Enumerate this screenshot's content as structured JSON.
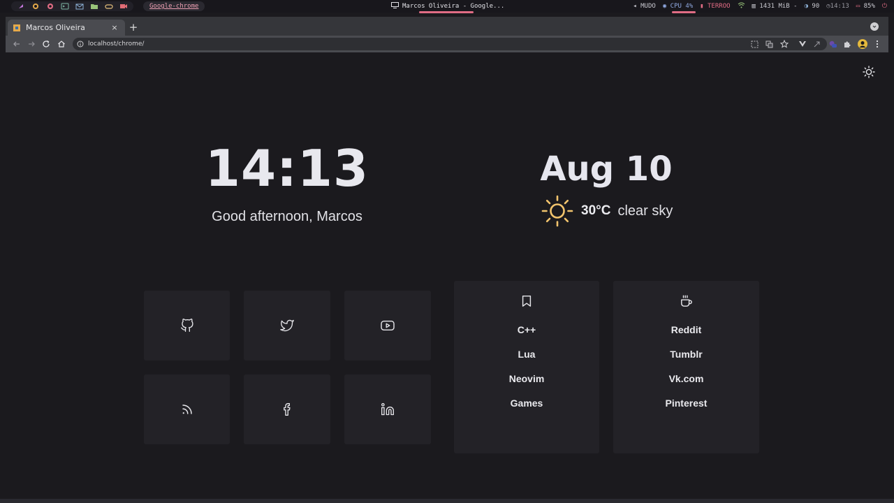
{
  "system_bar": {
    "active_window_label": "Google-chrome",
    "window_title": "Marcos Oliveira - Google...",
    "mute_label": "MUDO",
    "cpu_label": "CPU 4%",
    "temp_label": "TERROO",
    "memory_label": "1431 MiB -",
    "brightness_label": "90",
    "time_label": "14:13",
    "battery_label": "85%",
    "colors": {
      "accent": "#e06c84",
      "active_text": "#f0a1b4"
    }
  },
  "browser": {
    "tab_title": "Marcos Oliveira",
    "tab_close": "×",
    "new_tab": "+",
    "url": "localhost/chrome/"
  },
  "page": {
    "clock": "14:13",
    "greeting": "Good afternoon, Marcos",
    "date": "Aug 10",
    "weather": {
      "temperature": "30°C",
      "description": "clear sky",
      "icon": "sun-icon"
    },
    "social_links": [
      {
        "name": "github",
        "icon": "github-icon"
      },
      {
        "name": "twitter",
        "icon": "twitter-icon"
      },
      {
        "name": "youtube",
        "icon": "youtube-icon"
      },
      {
        "name": "rss",
        "icon": "rss-icon"
      },
      {
        "name": "facebook",
        "icon": "facebook-icon"
      },
      {
        "name": "linkedin",
        "icon": "linkedin-icon"
      }
    ],
    "bookmarks": {
      "icon": "bookmark-icon",
      "items": [
        "C++",
        "Lua",
        "Neovim",
        "Games"
      ]
    },
    "leisure": {
      "icon": "coffee-icon",
      "items": [
        "Reddit",
        "Tumblr",
        "Vk.com",
        "Pinterest"
      ]
    },
    "colors": {
      "background": "#1b1a1e",
      "card": "#232227",
      "sun": "#f2c46d"
    }
  }
}
